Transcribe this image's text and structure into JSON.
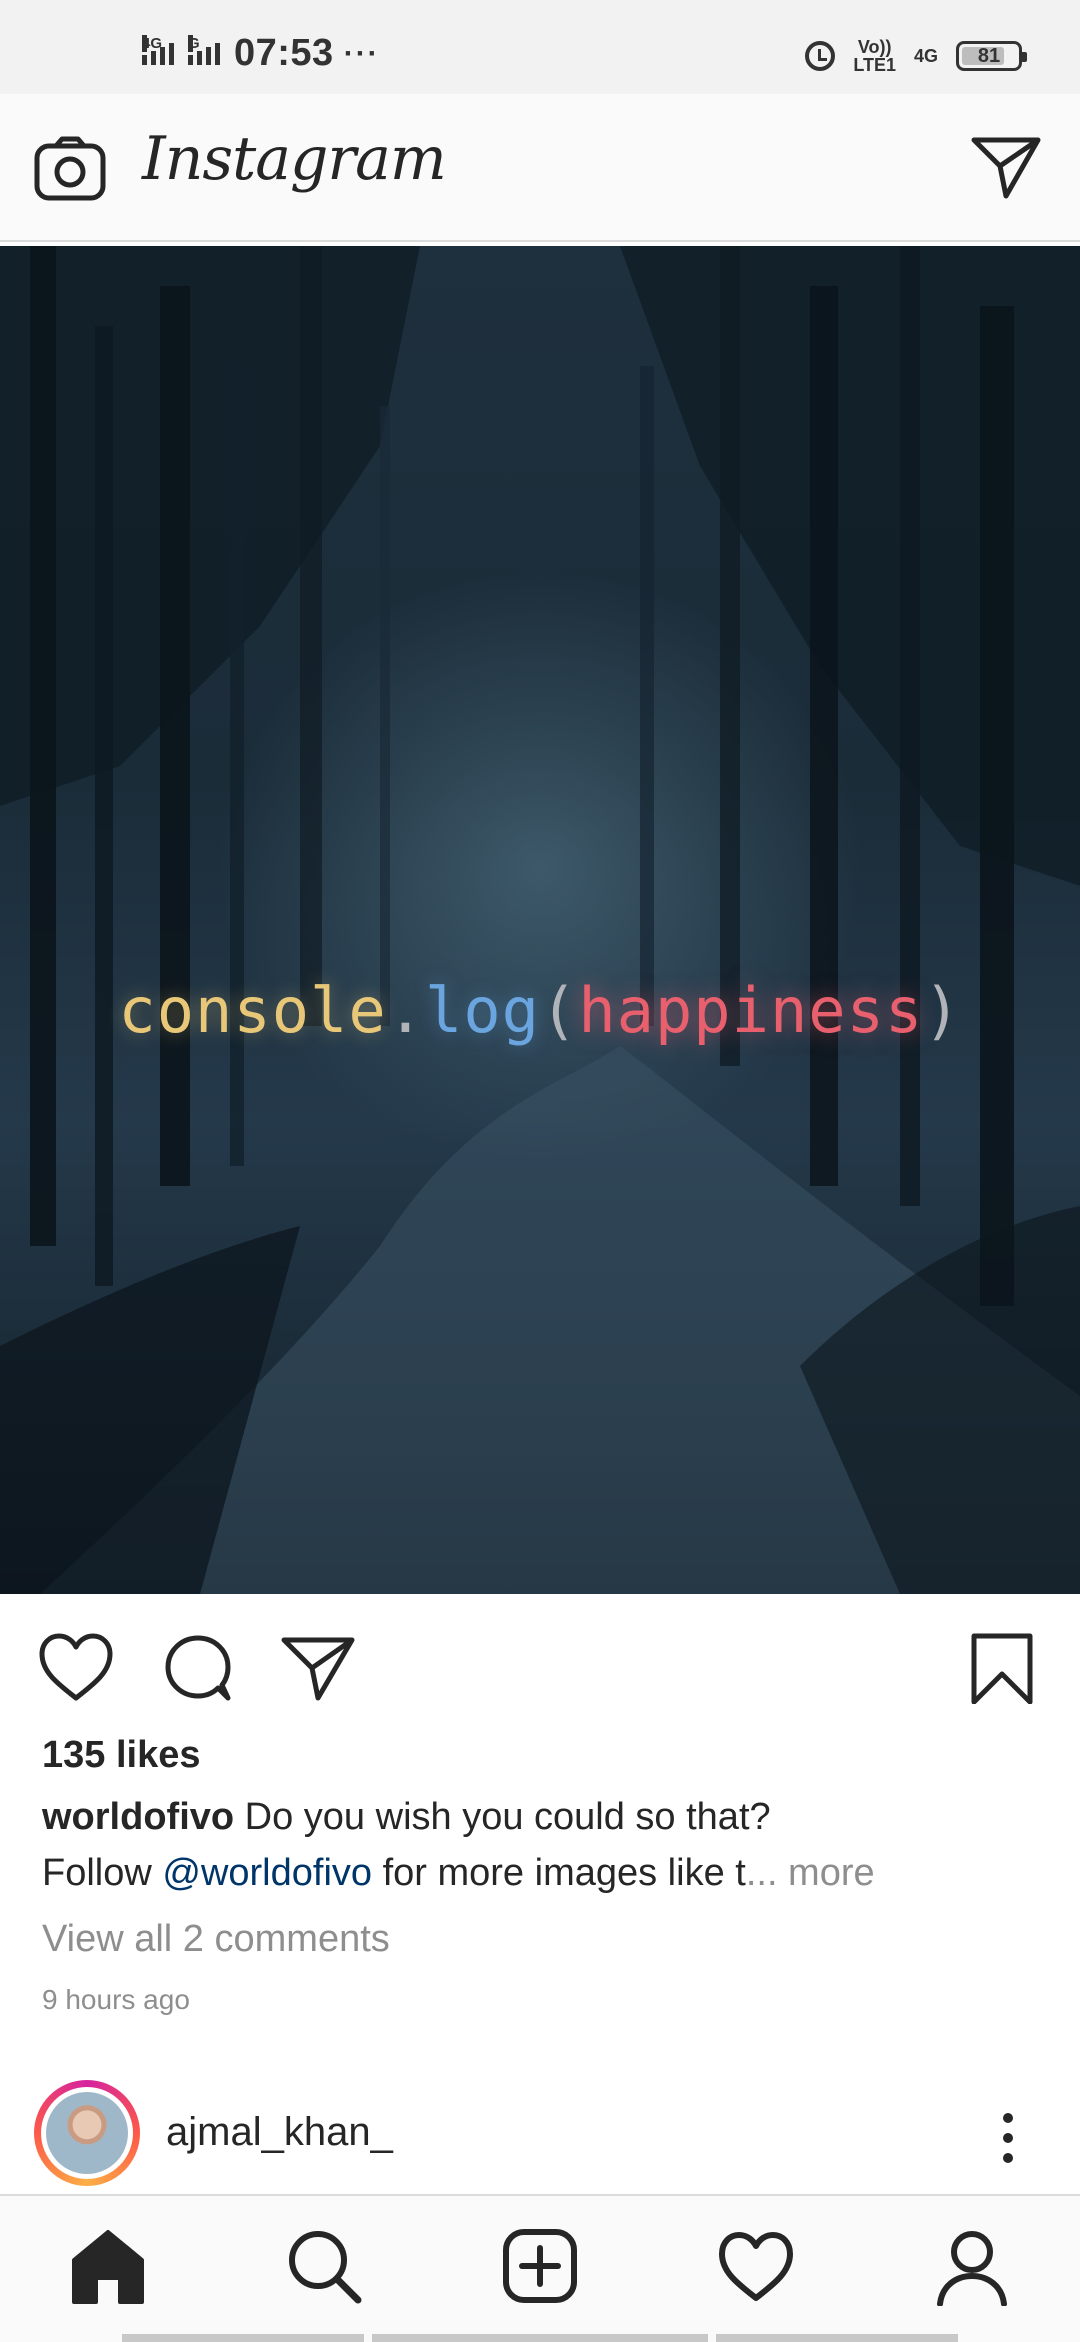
{
  "status_bar": {
    "time": "07:53",
    "overflow": "···",
    "sim1": "4G",
    "sim2": "G",
    "volte_top": "Vo))",
    "volte_bottom": "LTE1",
    "net": "4G",
    "battery": "81"
  },
  "app_bar": {
    "title": "Instagram",
    "left_icon": "camera-icon",
    "right_icon": "direct-message-icon"
  },
  "post": {
    "image_text": {
      "part1": "console",
      "dot": ".",
      "part2": "log",
      "open": "(",
      "part3": "happiness",
      "close": ")"
    },
    "likes": "135 likes",
    "username": "worldofivo",
    "caption_text": " Do you wish you could so that?",
    "caption_line2_prefix": "Follow ",
    "mention": "@worldofivo",
    "caption_line2_suffix": " for more images like t",
    "more": "... more",
    "view_comments": "View all 2 comments",
    "time_ago": "9 hours ago"
  },
  "next_post": {
    "username": "ajmal_khan_"
  },
  "bottom_nav": {
    "items": [
      "home-icon",
      "search-icon",
      "new-post-icon",
      "activity-heart-icon",
      "profile-icon"
    ]
  },
  "colors": {
    "mention": "#003569",
    "muted": "#8e8e8e",
    "text": "#262626"
  }
}
